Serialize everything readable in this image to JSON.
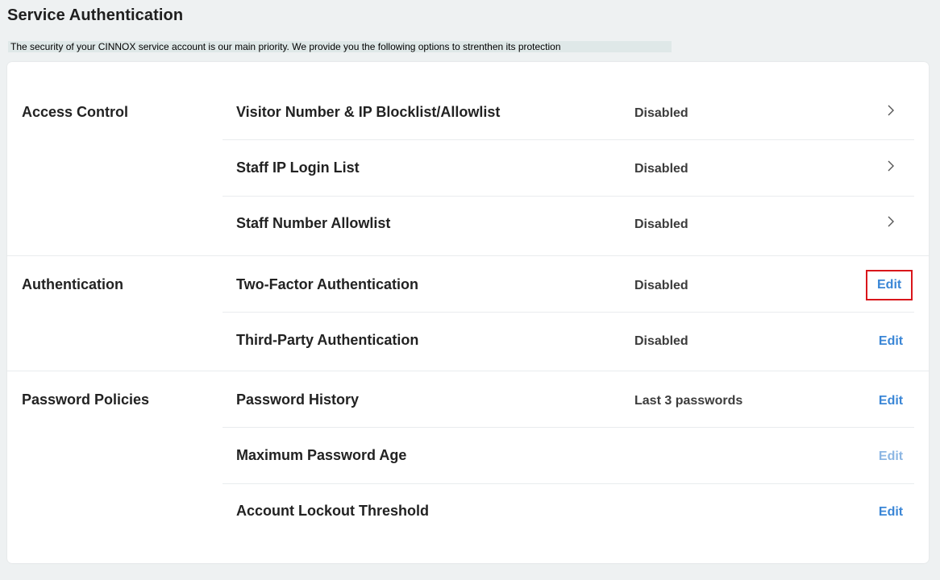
{
  "page": {
    "title": "Service Authentication",
    "subtitle": "The security of your CINNOX service account is our main priority. We provide you the following options to strenthen its protection"
  },
  "sections": [
    {
      "label": "Access Control",
      "rows": [
        {
          "name": "Visitor Number & IP Blocklist/Allowlist",
          "status": "Disabled",
          "action": "chevron-right-icon"
        },
        {
          "name": "Staff IP Login List",
          "status": "Disabled",
          "action": "chevron-right-icon"
        },
        {
          "name": "Staff Number Allowlist",
          "status": "Disabled",
          "action": "chevron-right-icon"
        }
      ]
    },
    {
      "label": "Authentication",
      "rows": [
        {
          "name": "Two-Factor Authentication",
          "status": "Disabled",
          "action": "Edit"
        },
        {
          "name": "Third-Party Authentication",
          "status": "Disabled",
          "action": "Edit"
        }
      ]
    },
    {
      "label": "Password Policies",
      "rows": [
        {
          "name": "Password History",
          "status": "Last 3 passwords",
          "action": "Edit"
        },
        {
          "name": "Maximum Password Age",
          "status": "",
          "action": "Edit"
        },
        {
          "name": "Account Lockout Threshold",
          "status": "",
          "action": "Edit"
        }
      ]
    }
  ],
  "colors": {
    "background": "#eef1f2",
    "card": "#ffffff",
    "link": "#3a86d6",
    "highlight": "#d9161b"
  }
}
